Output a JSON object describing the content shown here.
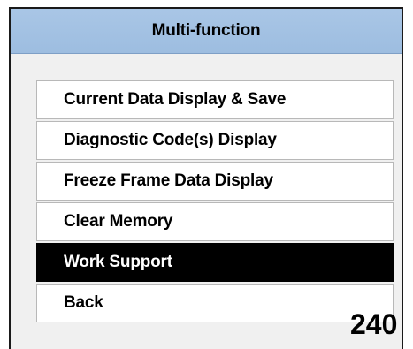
{
  "window": {
    "title": "Multi-function"
  },
  "menu": {
    "items": [
      {
        "label": "Current Data Display & Save",
        "selected": false
      },
      {
        "label": "Diagnostic Code(s) Display",
        "selected": false
      },
      {
        "label": "Freeze Frame Data Display",
        "selected": false
      },
      {
        "label": "Clear Memory",
        "selected": false
      },
      {
        "label": "Work Support",
        "selected": true
      },
      {
        "label": "Back",
        "selected": false
      }
    ]
  },
  "page_number": "240",
  "colors": {
    "title_bar": "#a9c6e6",
    "selected_bg": "#000000",
    "selected_fg": "#ffffff",
    "item_bg": "#ffffff",
    "window_bg": "#f0f0f0"
  }
}
